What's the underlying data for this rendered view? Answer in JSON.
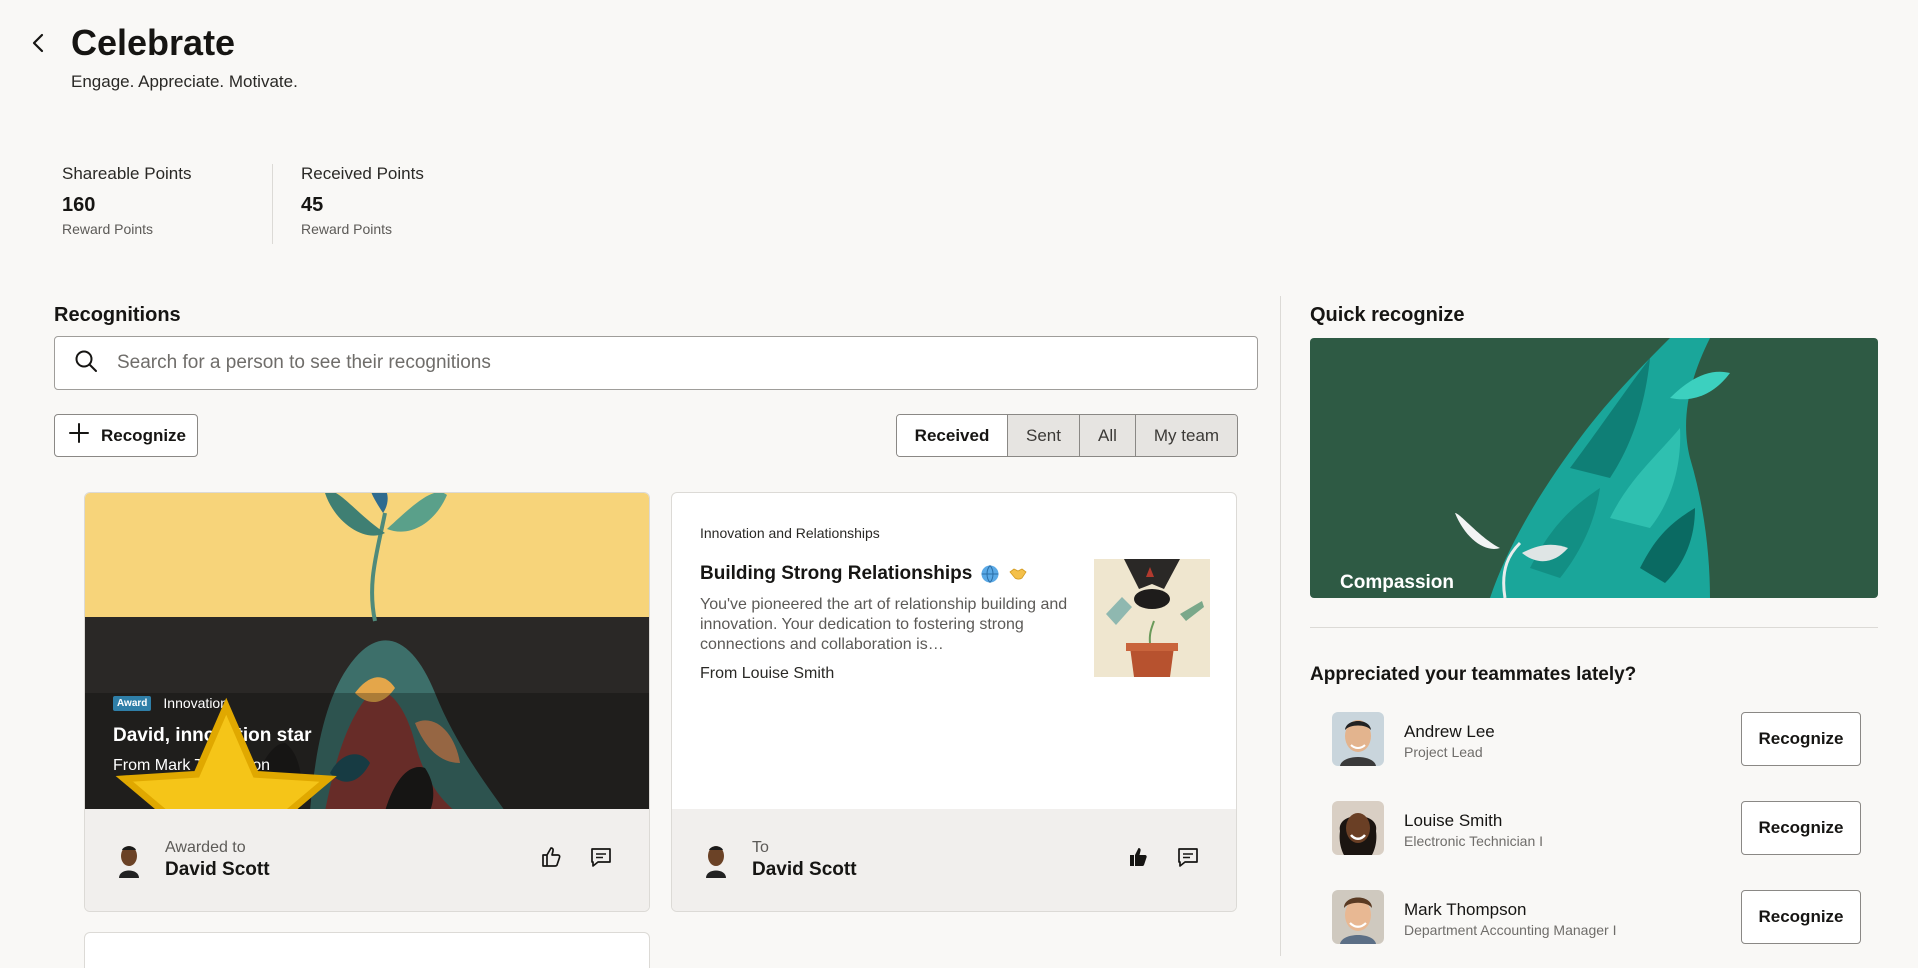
{
  "header": {
    "title": "Celebrate",
    "subtitle": "Engage. Appreciate. Motivate."
  },
  "points": {
    "shareable": {
      "label": "Shareable Points",
      "value": "160",
      "unit": "Reward Points"
    },
    "received": {
      "label": "Received Points",
      "value": "45",
      "unit": "Reward Points"
    }
  },
  "recognitions": {
    "title": "Recognitions",
    "search_placeholder": "Search for a person to see their recognitions",
    "recognize_label": "Recognize",
    "filters": [
      "Received",
      "Sent",
      "All",
      "My team"
    ],
    "active_filter": "Received",
    "cards": [
      {
        "badge": "Award",
        "category": "Innovation",
        "title": "David, innovation star",
        "from": "From Mark Thompson",
        "footer_label": "Awarded to",
        "footer_name": "David Scott",
        "liked": false
      },
      {
        "category": "Innovation and Relationships",
        "title": "Building Strong Relationships",
        "description": "You've pioneered the art of relationship building and innovation. Your dedication to fostering strong connections and collaboration is…",
        "from": "From Louise Smith",
        "footer_label": "To",
        "footer_name": "David Scott",
        "liked": true
      }
    ]
  },
  "quick": {
    "title": "Quick recognize",
    "banner_label": "Compassion",
    "prompt": "Appreciated your teammates lately?",
    "button_label": "Recognize",
    "people": [
      {
        "name": "Andrew Lee",
        "role": "Project Lead"
      },
      {
        "name": "Louise Smith",
        "role": "Electronic Technician I"
      },
      {
        "name": "Mark Thompson",
        "role": "Department Accounting Manager I"
      }
    ]
  },
  "colors": {
    "background": "#f9f8f6",
    "award_badge": "#2f7fa8",
    "banner_green": "#2e5a44",
    "banner_teal": "#1aa69a"
  },
  "icons": [
    "back-chevron-icon",
    "search-icon",
    "plus-icon",
    "star-icon",
    "globe-icon",
    "handshake-icon",
    "thumbs-up-icon",
    "comment-icon"
  ]
}
